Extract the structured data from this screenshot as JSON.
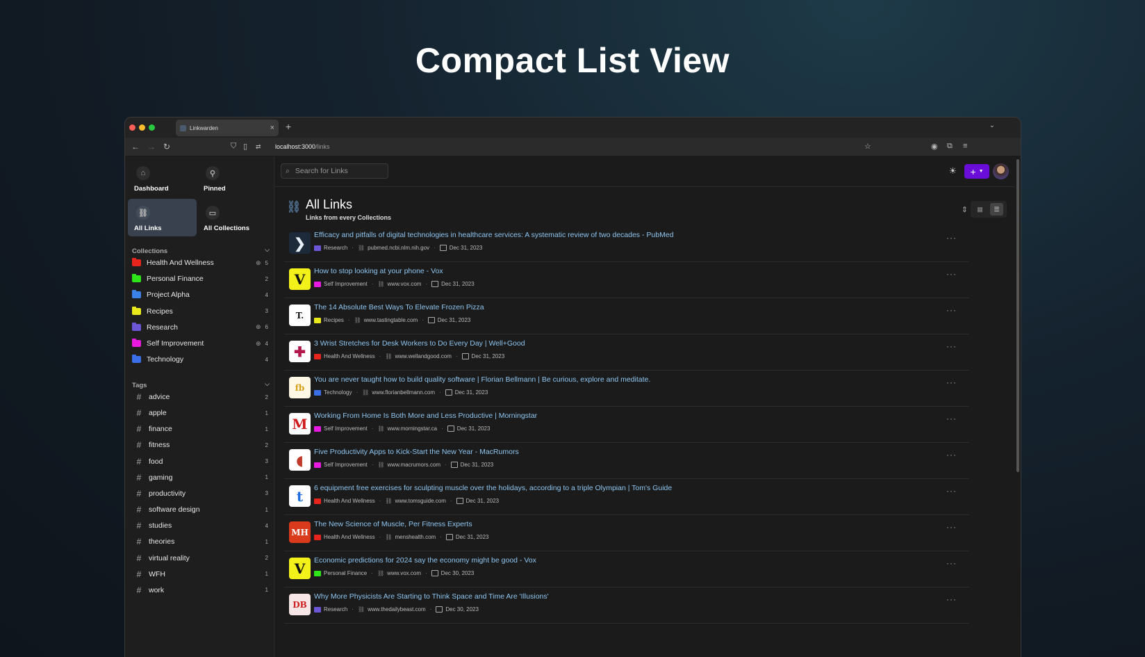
{
  "hero_title": "Compact List View",
  "browser": {
    "tab_title": "Linkwarden",
    "url_host": "localhost:3000",
    "url_path": "/links"
  },
  "sidebar": {
    "tiles": [
      {
        "label": "Dashboard",
        "icon": "house-icon"
      },
      {
        "label": "Pinned",
        "icon": "pin-icon"
      },
      {
        "label": "All Links",
        "icon": "link-icon"
      },
      {
        "label": "All Collections",
        "icon": "folder-icon"
      }
    ],
    "collections_heading": "Collections",
    "collections": [
      {
        "name": "Health And Wellness",
        "color": "#e8251c",
        "count": "5",
        "shared": true
      },
      {
        "name": "Personal Finance",
        "color": "#2ee61a",
        "count": "2",
        "shared": false
      },
      {
        "name": "Project Alpha",
        "color": "#3b82e6",
        "count": "4",
        "shared": false
      },
      {
        "name": "Recipes",
        "color": "#e8e81a",
        "count": "3",
        "shared": false
      },
      {
        "name": "Research",
        "color": "#6d56d6",
        "count": "6",
        "shared": true
      },
      {
        "name": "Self Improvement",
        "color": "#e81ae0",
        "count": "4",
        "shared": true
      },
      {
        "name": "Technology",
        "color": "#3b6fe8",
        "count": "4",
        "shared": false
      }
    ],
    "tags_heading": "Tags",
    "tags": [
      {
        "name": "advice",
        "count": "2"
      },
      {
        "name": "apple",
        "count": "1"
      },
      {
        "name": "finance",
        "count": "1"
      },
      {
        "name": "fitness",
        "count": "2"
      },
      {
        "name": "food",
        "count": "3"
      },
      {
        "name": "gaming",
        "count": "1"
      },
      {
        "name": "productivity",
        "count": "3"
      },
      {
        "name": "software design",
        "count": "1"
      },
      {
        "name": "studies",
        "count": "4"
      },
      {
        "name": "theories",
        "count": "1"
      },
      {
        "name": "virtual reality",
        "count": "2"
      },
      {
        "name": "WFH",
        "count": "1"
      },
      {
        "name": "work",
        "count": "1"
      }
    ]
  },
  "search": {
    "placeholder": "Search for Links"
  },
  "page": {
    "title": "All Links",
    "subtitle": "Links from every Collections"
  },
  "links": [
    {
      "title": "Efficacy and pitfalls of digital technologies in healthcare services: A systematic review of two decades - PubMed",
      "collection": "Research",
      "color": "#6d56d6",
      "domain": "pubmed.ncbi.nlm.nih.gov",
      "date": "Dec 31, 2023",
      "fav_text": "❯",
      "fav_bg": "#1d2a3a",
      "fav_fg": "#e8eef5"
    },
    {
      "title": "How to stop looking at your phone - Vox",
      "collection": "Self Improvement",
      "color": "#e81ae0",
      "domain": "www.vox.com",
      "date": "Dec 31, 2023",
      "fav_text": "V",
      "fav_bg": "#f2f21a",
      "fav_fg": "#111111"
    },
    {
      "title": "The 14 Absolute Best Ways To Elevate Frozen Pizza",
      "collection": "Recipes",
      "color": "#e8e81a",
      "domain": "www.tastingtable.com",
      "date": "Dec 31, 2023",
      "fav_text": "T.",
      "fav_bg": "#ffffff",
      "fav_fg": "#111111"
    },
    {
      "title": "3 Wrist Stretches for Desk Workers to Do Every Day | Well+Good",
      "collection": "Health And Wellness",
      "color": "#e8251c",
      "domain": "www.wellandgood.com",
      "date": "Dec 31, 2023",
      "fav_text": "✚",
      "fav_bg": "#ffffff",
      "fav_fg": "#b0174a"
    },
    {
      "title": "You are never taught how to build quality software | Florian Bellmann | Be curious, explore and meditate.",
      "collection": "Technology",
      "color": "#3b6fe8",
      "domain": "www.florianbellmann.com",
      "date": "Dec 31, 2023",
      "fav_text": "fb",
      "fav_bg": "#fff7e6",
      "fav_fg": "#d4a017"
    },
    {
      "title": "Working From Home Is Both More and Less Productive | Morningstar",
      "collection": "Self Improvement",
      "color": "#e81ae0",
      "domain": "www.morningstar.ca",
      "date": "Dec 31, 2023",
      "fav_text": "M",
      "fav_bg": "#ffffff",
      "fav_fg": "#d01c1c"
    },
    {
      "title": "Five Productivity Apps to Kick-Start the New Year - MacRumors",
      "collection": "Self Improvement",
      "color": "#e81ae0",
      "domain": "www.macrumors.com",
      "date": "Dec 31, 2023",
      "fav_text": "◖",
      "fav_bg": "#ffffff",
      "fav_fg": "#c0392b"
    },
    {
      "title": "6 equipment free exercises for sculpting muscle over the holidays, according to a triple Olympian | Tom's Guide",
      "collection": "Health And Wellness",
      "color": "#e8251c",
      "domain": "www.tomsguide.com",
      "date": "Dec 31, 2023",
      "fav_text": "t",
      "fav_bg": "#ffffff",
      "fav_fg": "#1f6fe0"
    },
    {
      "title": "The New Science of Muscle, Per Fitness Experts",
      "collection": "Health And Wellness",
      "color": "#e8251c",
      "domain": "menshealth.com",
      "date": "Dec 31, 2023",
      "fav_text": "MH",
      "fav_bg": "#d93a1c",
      "fav_fg": "#ffffff"
    },
    {
      "title": "Economic predictions for 2024 say the economy might be good - Vox",
      "collection": "Personal Finance",
      "color": "#2ee61a",
      "domain": "www.vox.com",
      "date": "Dec 30, 2023",
      "fav_text": "V",
      "fav_bg": "#f2f21a",
      "fav_fg": "#111111"
    },
    {
      "title": "Why More Physicists Are Starting to Think Space and Time Are 'Illusions'",
      "collection": "Research",
      "color": "#6d56d6",
      "domain": "www.thedailybeast.com",
      "date": "Dec 30, 2023",
      "fav_text": "DB",
      "fav_bg": "#f6e6e6",
      "fav_fg": "#d01c1c"
    }
  ]
}
